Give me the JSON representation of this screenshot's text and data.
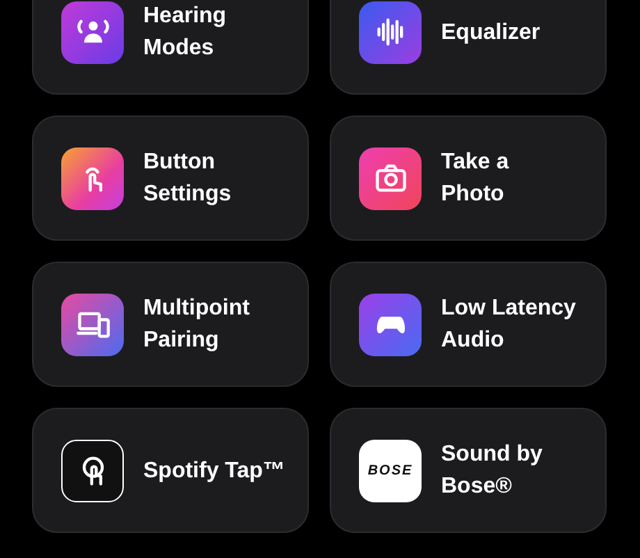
{
  "tiles": [
    {
      "kind": "hearing",
      "lines": [
        "Hearing",
        "Modes"
      ]
    },
    {
      "kind": "equalizer",
      "lines": [
        "Equalizer"
      ]
    },
    {
      "kind": "button",
      "lines": [
        "Button",
        "Settings"
      ]
    },
    {
      "kind": "camera",
      "lines": [
        "Take a",
        "Photo"
      ]
    },
    {
      "kind": "multipoint",
      "lines": [
        "Multipoint",
        "Pairing"
      ]
    },
    {
      "kind": "gamepad",
      "lines": [
        "Low Latency",
        "Audio"
      ]
    },
    {
      "kind": "spotify",
      "lines": [
        "Spotify Tap™"
      ]
    },
    {
      "kind": "bose",
      "lines": [
        "Sound by",
        "Bose®"
      ],
      "logo_text": "BOSE"
    }
  ]
}
